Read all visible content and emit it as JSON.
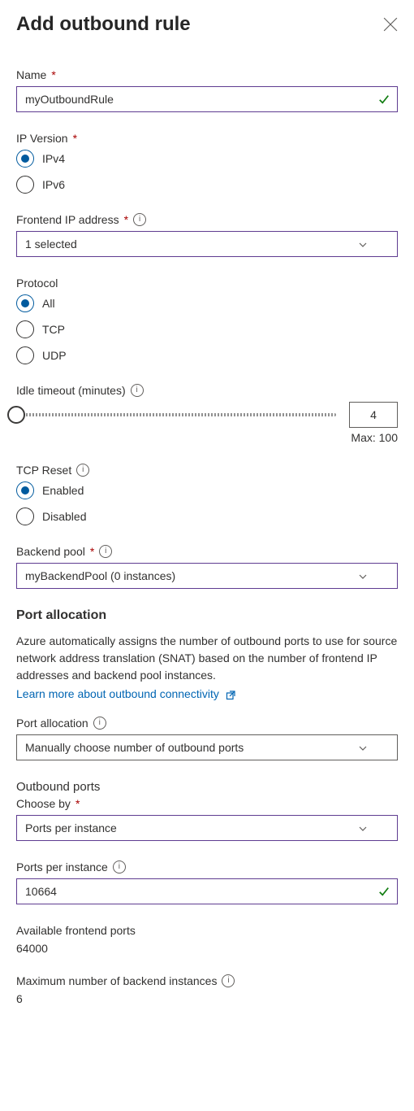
{
  "header": {
    "title": "Add outbound rule"
  },
  "fields": {
    "name": {
      "label": "Name",
      "value": "myOutboundRule",
      "required": true,
      "valid": true
    },
    "ipVersion": {
      "label": "IP Version",
      "required": true,
      "options": {
        "v4": "IPv4",
        "v6": "IPv6"
      },
      "selected": "v4"
    },
    "frontendIp": {
      "label": "Frontend IP address",
      "required": true,
      "value": "1 selected"
    },
    "protocol": {
      "label": "Protocol",
      "options": {
        "all": "All",
        "tcp": "TCP",
        "udp": "UDP"
      },
      "selected": "all"
    },
    "idleTimeout": {
      "label": "Idle timeout (minutes)",
      "value": "4",
      "maxLabel": "Max: 100"
    },
    "tcpReset": {
      "label": "TCP Reset",
      "options": {
        "en": "Enabled",
        "dis": "Disabled"
      },
      "selected": "en"
    },
    "backendPool": {
      "label": "Backend pool",
      "required": true,
      "value": "myBackendPool (0 instances)"
    }
  },
  "portAllocation": {
    "sectionTitle": "Port allocation",
    "desc": "Azure automatically assigns the number of outbound ports to use for source network address translation (SNAT) based on the number of frontend IP addresses and backend pool instances.",
    "learnMore": "Learn more about outbound connectivity",
    "allocation": {
      "label": "Port allocation",
      "value": "Manually choose number of outbound ports"
    },
    "outboundPortsTitle": "Outbound ports",
    "chooseBy": {
      "label": "Choose by",
      "required": true,
      "value": "Ports per instance"
    },
    "portsPerInstance": {
      "label": "Ports per instance",
      "value": "10664",
      "valid": true
    },
    "availablePorts": {
      "label": "Available frontend ports",
      "value": "64000"
    },
    "maxBackend": {
      "label": "Maximum number of backend instances",
      "value": "6"
    }
  }
}
